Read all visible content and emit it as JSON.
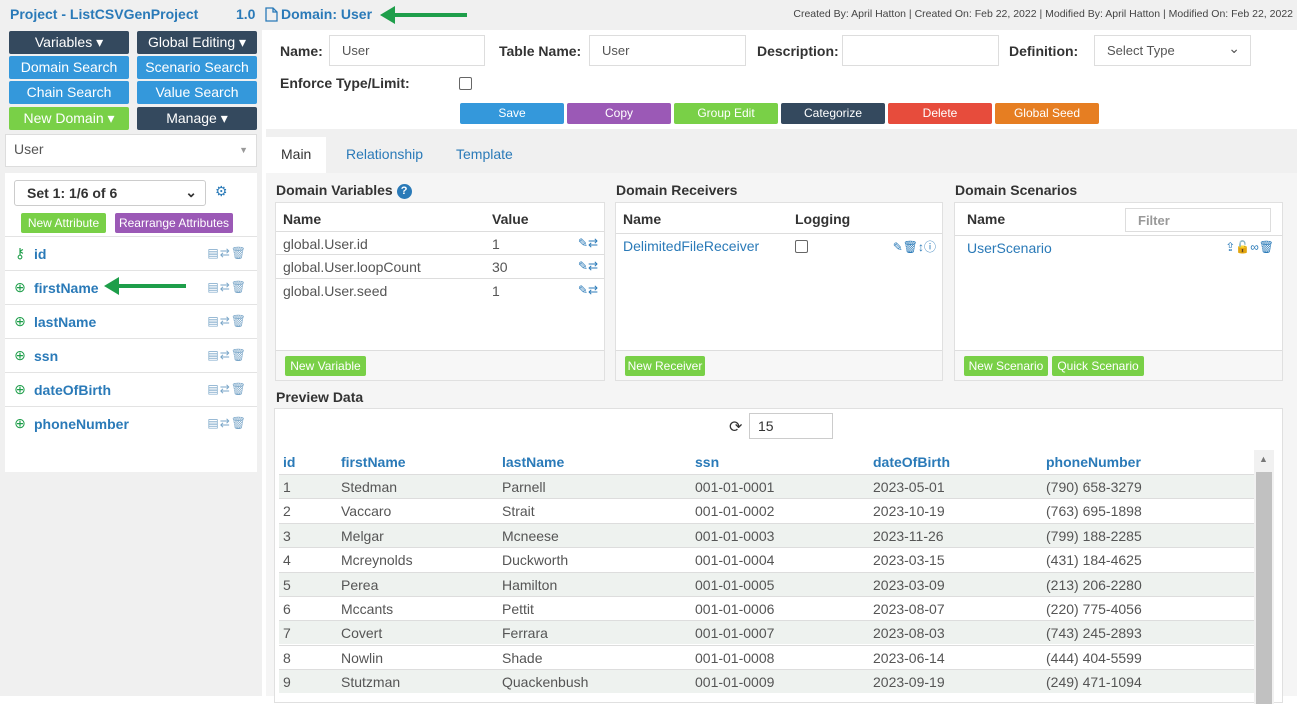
{
  "header": {
    "project": "Project - ListCSVGenProject",
    "version": "1.0",
    "domain_title": "Domain: User",
    "created_info": "Created By: April Hatton | Created On: Feb 22, 2022 | Modified By: April Hatton | Modified On: Feb 22, 2022"
  },
  "nav": {
    "variables": "Variables ▾",
    "global_editing": "Global Editing ▾",
    "domain_search": "Domain Search",
    "scenario_search": "Scenario Search",
    "chain_search": "Chain Search",
    "value_search": "Value Search",
    "new_domain": "New Domain ▾",
    "manage": "Manage ▾",
    "domain_select": "User"
  },
  "attributes": {
    "set_label": "Set 1: 1/6 of 6",
    "new_attribute": "New Attribute",
    "rearrange": "Rearrange Attributes",
    "items": [
      "id",
      "firstName",
      "lastName",
      "ssn",
      "dateOfBirth",
      "phoneNumber"
    ]
  },
  "form": {
    "name_label": "Name:",
    "name_value": "User",
    "table_label": "Table Name:",
    "table_value": "User",
    "desc_label": "Description:",
    "desc_value": "",
    "def_label": "Definition:",
    "def_value": "Select Type",
    "enforce_label": "Enforce Type/Limit:"
  },
  "actions": {
    "save": "Save",
    "copy": "Copy",
    "group_edit": "Group Edit",
    "categorize": "Categorize",
    "delete": "Delete",
    "global_seed": "Global Seed"
  },
  "tabs": {
    "main": "Main",
    "relationship": "Relationship",
    "template": "Template"
  },
  "variables": {
    "title": "Domain Variables",
    "col_name": "Name",
    "col_value": "Value",
    "rows": [
      {
        "name": "global.User.id",
        "value": "1"
      },
      {
        "name": "global.User.loopCount",
        "value": "30"
      },
      {
        "name": "global.User.seed",
        "value": "1"
      }
    ],
    "new_button": "New Variable"
  },
  "receivers": {
    "title": "Domain Receivers",
    "col_name": "Name",
    "col_logging": "Logging",
    "item": "DelimitedFileReceiver",
    "new_button": "New Receiver"
  },
  "scenarios": {
    "title": "Domain Scenarios",
    "col_name": "Name",
    "filter_placeholder": "Filter",
    "item": "UserScenario",
    "new_button": "New Scenario",
    "quick_button": "Quick Scenario"
  },
  "preview": {
    "title": "Preview Data",
    "count": "15",
    "columns": [
      "id",
      "firstName",
      "lastName",
      "ssn",
      "dateOfBirth",
      "phoneNumber"
    ],
    "rows": [
      [
        "1",
        "Stedman",
        "Parnell",
        "001-01-0001",
        "2023-05-01",
        "(790) 658-3279"
      ],
      [
        "2",
        "Vaccaro",
        "Strait",
        "001-01-0002",
        "2023-10-19",
        "(763) 695-1898"
      ],
      [
        "3",
        "Melgar",
        "Mcneese",
        "001-01-0003",
        "2023-11-26",
        "(799) 188-2285"
      ],
      [
        "4",
        "Mcreynolds",
        "Duckworth",
        "001-01-0004",
        "2023-03-15",
        "(431) 184-4625"
      ],
      [
        "5",
        "Perea",
        "Hamilton",
        "001-01-0005",
        "2023-03-09",
        "(213) 206-2280"
      ],
      [
        "6",
        "Mccants",
        "Pettit",
        "001-01-0006",
        "2023-08-07",
        "(220) 775-4056"
      ],
      [
        "7",
        "Covert",
        "Ferrara",
        "001-01-0007",
        "2023-08-03",
        "(743) 245-2893"
      ],
      [
        "8",
        "Nowlin",
        "Shade",
        "001-01-0008",
        "2023-06-14",
        "(444) 404-5599"
      ],
      [
        "9",
        "Stutzman",
        "Quackenbush",
        "001-01-0009",
        "2023-09-19",
        "(249) 471-1094"
      ]
    ]
  },
  "colors": {
    "accent": "#2a7ab8",
    "dark_btn": "#34495e",
    "blue_btn": "#3498db",
    "green_btn": "#79d047",
    "purple_btn": "#9b59b6",
    "red_btn": "#e74c3c",
    "orange_btn": "#e67e22",
    "arrow": "#1e9e4a"
  }
}
